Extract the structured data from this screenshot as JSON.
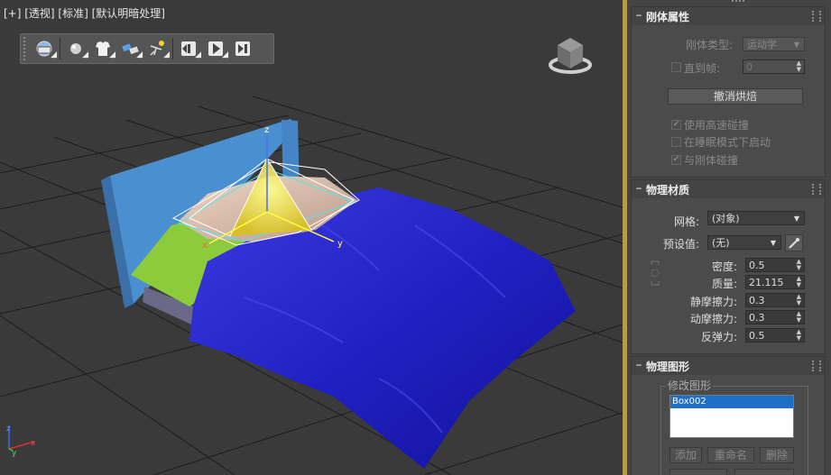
{
  "viewport": {
    "label": "[+] [透视] [标准] [默认明暗处理]",
    "axis_labels": {
      "x": "x",
      "y": "y",
      "z": "z"
    },
    "toolbar": [
      {
        "name": "mass-fx-explorer-icon"
      },
      {
        "name": "rigid-body-icon"
      },
      {
        "name": "cloth-icon"
      },
      {
        "name": "constraint-icon"
      },
      {
        "name": "ragdoll-icon"
      },
      {
        "name": "reset-simulation-icon"
      },
      {
        "name": "start-simulation-icon"
      },
      {
        "name": "step-simulation-icon"
      }
    ]
  },
  "panel_rigid": {
    "title": "刚体属性",
    "type_label": "刚体类型:",
    "type_value": "运动学",
    "until_frame_label": "直到帧:",
    "until_frame_value": "0",
    "uncook_button": "撤消烘焙",
    "opt_high_speed": "使用高速碰撞",
    "opt_sleep": "在睡眠模式下启动",
    "opt_collide": "与刚体碰撞"
  },
  "panel_material": {
    "title": "物理材质",
    "mesh_label": "网格:",
    "mesh_value": "(对象)",
    "preset_label": "预设值:",
    "preset_value": "(无)",
    "density_label": "密度:",
    "density_value": "0.5",
    "mass_label": "质量:",
    "mass_value": "21.115",
    "static_friction_label": "静摩擦力:",
    "static_friction_value": "0.3",
    "dynamic_friction_label": "动摩擦力:",
    "dynamic_friction_value": "0.3",
    "bounciness_label": "反弹力:",
    "bounciness_value": "0.5"
  },
  "panel_shapes": {
    "title": "物理图形",
    "group_title": "修改图形",
    "list_items": [
      "Box002"
    ],
    "add_button": "添加",
    "rename_button": "重命名",
    "delete_button": "删除"
  },
  "colors": {
    "viewport_bg": "#3a3a3a",
    "panel_bg": "#444444",
    "divider": "#b59a50",
    "selection": "#1e6fc9",
    "sheet_blue": "#2020c8",
    "headboard_blue": "#4a8fd0",
    "mattress_green": "#8ccc3c"
  }
}
